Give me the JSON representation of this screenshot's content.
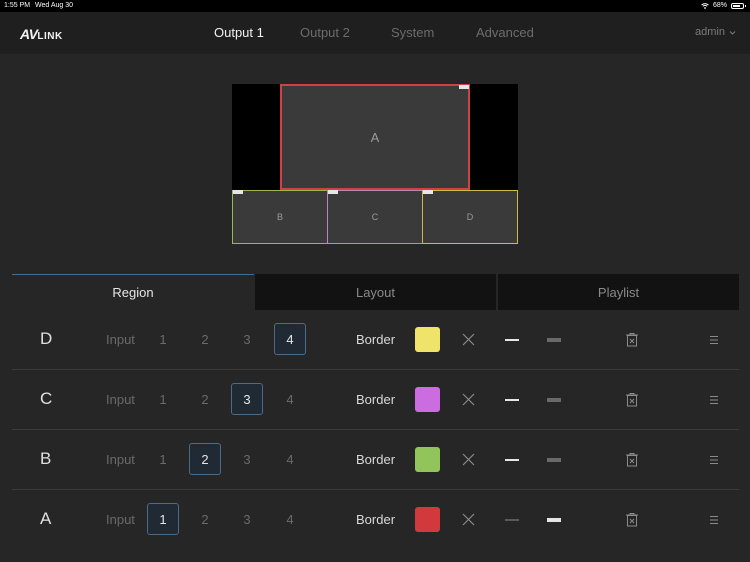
{
  "status": {
    "time": "1:55 PM",
    "date": "Wed Aug 30",
    "battery": "68%"
  },
  "header": {
    "logo_main": "AV",
    "logo_sub": "LINK",
    "tabs": [
      {
        "label": "Output 1",
        "active": true
      },
      {
        "label": "Output 2",
        "active": false
      },
      {
        "label": "System",
        "active": false
      },
      {
        "label": "Advanced",
        "active": false
      }
    ],
    "user": "admin"
  },
  "preview": {
    "regions": [
      {
        "label": "A",
        "color": "#d04145"
      },
      {
        "label": "B",
        "color": "#9ab84f"
      },
      {
        "label": "C",
        "color": "#b98ab9"
      },
      {
        "label": "D",
        "color": "#c9bc4a"
      }
    ]
  },
  "tabs": [
    {
      "label": "Region",
      "active": true
    },
    {
      "label": "Layout",
      "active": false
    },
    {
      "label": "Playlist",
      "active": false
    }
  ],
  "rows": [
    {
      "letter": "D",
      "input_label": "Input",
      "inputs": [
        "1",
        "2",
        "3",
        "4"
      ],
      "selected": "4",
      "border_label": "Border",
      "color": "#f0e369",
      "thin_active": true,
      "thick_active": false
    },
    {
      "letter": "C",
      "input_label": "Input",
      "inputs": [
        "1",
        "2",
        "3",
        "4"
      ],
      "selected": "3",
      "border_label": "Border",
      "color": "#cb6de0",
      "thin_active": true,
      "thick_active": false
    },
    {
      "letter": "B",
      "input_label": "Input",
      "inputs": [
        "1",
        "2",
        "3",
        "4"
      ],
      "selected": "2",
      "border_label": "Border",
      "color": "#91c45a",
      "thin_active": true,
      "thick_active": false
    },
    {
      "letter": "A",
      "input_label": "Input",
      "inputs": [
        "1",
        "2",
        "3",
        "4"
      ],
      "selected": "1",
      "border_label": "Border",
      "color": "#d1393d",
      "thin_active": false,
      "thick_active": true
    }
  ],
  "icons": {
    "wifi": "wifi-icon",
    "battery": "battery-icon",
    "user_menu": "chevron-down-icon",
    "clear": "close-icon",
    "thin": "thin-border-icon",
    "thick": "thick-border-icon",
    "delete": "trash-icon",
    "reorder": "drag-handle-icon"
  }
}
